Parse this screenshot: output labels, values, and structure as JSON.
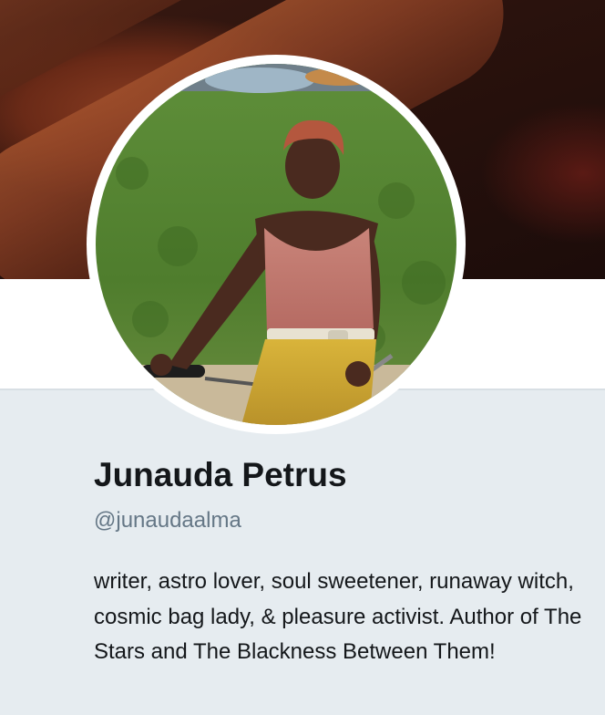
{
  "profile": {
    "name": "Junauda Petrus",
    "handle": "@junaudaalma",
    "bio": "writer, astro lover, soul sweetener, runaway witch, cosmic bag lady, & pleasure activist. Author of The Stars and The Blackness Between Them!"
  },
  "colors": {
    "name_text": "#14171a",
    "handle_text": "#657786",
    "page_background": "#e6ecf0",
    "card_background": "#ffffff"
  }
}
